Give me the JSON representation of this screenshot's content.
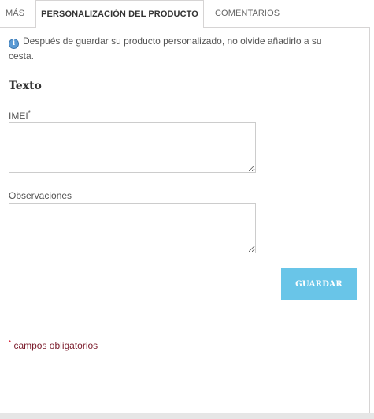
{
  "tabs": [
    {
      "label": "Más",
      "active": false
    },
    {
      "label": "Personalización del producto",
      "active": true
    },
    {
      "label": "Comentarios",
      "active": false
    }
  ],
  "info": {
    "icon": "info-icon",
    "text": "Después de guardar su producto personalizado, no olvide añadirlo a su cesta."
  },
  "section": {
    "title": "Texto"
  },
  "fields": {
    "imei_label": "IMEI",
    "imei_required_mark": "*",
    "imei_value": "",
    "observaciones_label": "Observaciones",
    "observaciones_value": ""
  },
  "actions": {
    "save_label": "Guardar"
  },
  "footer": {
    "required_mark": "*",
    "required_text": " campos obligatorios"
  },
  "colors": {
    "button": "#69c5e8",
    "info_icon": "#5b9bd5",
    "required_text": "#7a1a2a",
    "required_star": "#d0021b",
    "border": "#d6d4d4"
  }
}
